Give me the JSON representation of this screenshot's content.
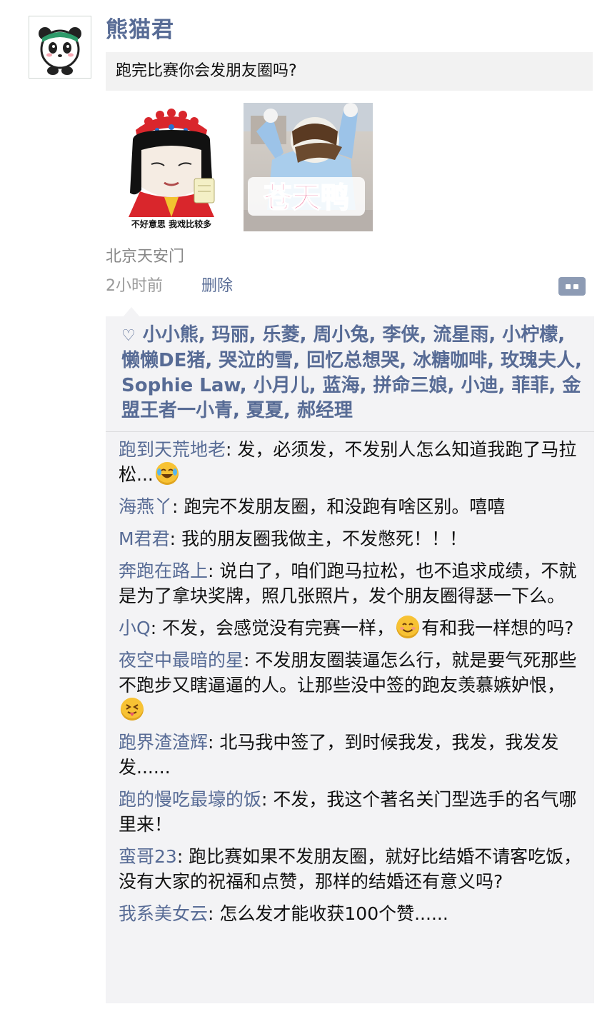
{
  "post": {
    "author": "熊猫君",
    "shared_title": "跑完比赛你会发朋友圈吗?",
    "images": [
      {
        "caption": "不好意思 我戏比较多"
      },
      {
        "caption": "苍天鸭"
      }
    ],
    "location": "北京天安门",
    "time": "2小时前",
    "delete_label": "删除"
  },
  "likes": {
    "names": "小小熊, 玛丽, 乐菱, 周小兔, 李侠, 流星雨, 小柠檬, 懒懒DE猪, 哭泣的雪, 回忆总想哭, 冰糖咖啡, 玫瑰夫人, Sophie Law, 小月儿, 蓝海, 拼命三娘, 小迪, 菲菲, 金盟王者一小青, 夏夏, 郝经理"
  },
  "comments": [
    {
      "author": "跑到天荒地老",
      "text": ": 发，必须发，不发别人怎么知道我跑了马拉松...",
      "emoji_after": "laugh-cry-emoji"
    },
    {
      "author": "海燕丫",
      "text": ": 跑完不发朋友圈，和没跑有啥区别。嘻嘻"
    },
    {
      "author": "M君君",
      "text": ": 我的朋友圈我做主，不发憋死！！！"
    },
    {
      "author": "奔跑在路上",
      "text": ": 说白了，咱们跑马拉松，也不追求成绩，不就是为了拿块奖牌，照几张照片，发个朋友圈得瑟一下么。"
    },
    {
      "author": "小Q",
      "text": ": 不发，会感觉没有完赛一样，",
      "emoji_mid": "smile-emoji",
      "text2": "有和我一样想的吗?"
    },
    {
      "author": "夜空中最暗的星",
      "text": ": 不发朋友圈装逼怎么行，就是要气死那些不跑步又瞎逼逼的人。让那些没中签的跑友羡慕嫉妒恨，",
      "emoji_after": "tongue-out-emoji"
    },
    {
      "author": "跑界渣渣辉",
      "text": ": 北马我中签了，到时候我发，我发，我发发发......"
    },
    {
      "author": "跑的慢吃最壕的饭",
      "text": ": 不发，我这个著名关门型选手的名气哪里来！"
    },
    {
      "author": "蛮哥23",
      "text": ": 跑比赛如果不发朋友圈，就好比结婚不请客吃饭，没有大家的祝福和点赞，那样的结婚还有意义吗?"
    },
    {
      "author": "我系美女云",
      "text": ": 怎么发才能收获100个赞......"
    }
  ],
  "colors": {
    "link": "#576b95",
    "panel": "#f3f3f5",
    "share_box": "#f2f2f2"
  }
}
